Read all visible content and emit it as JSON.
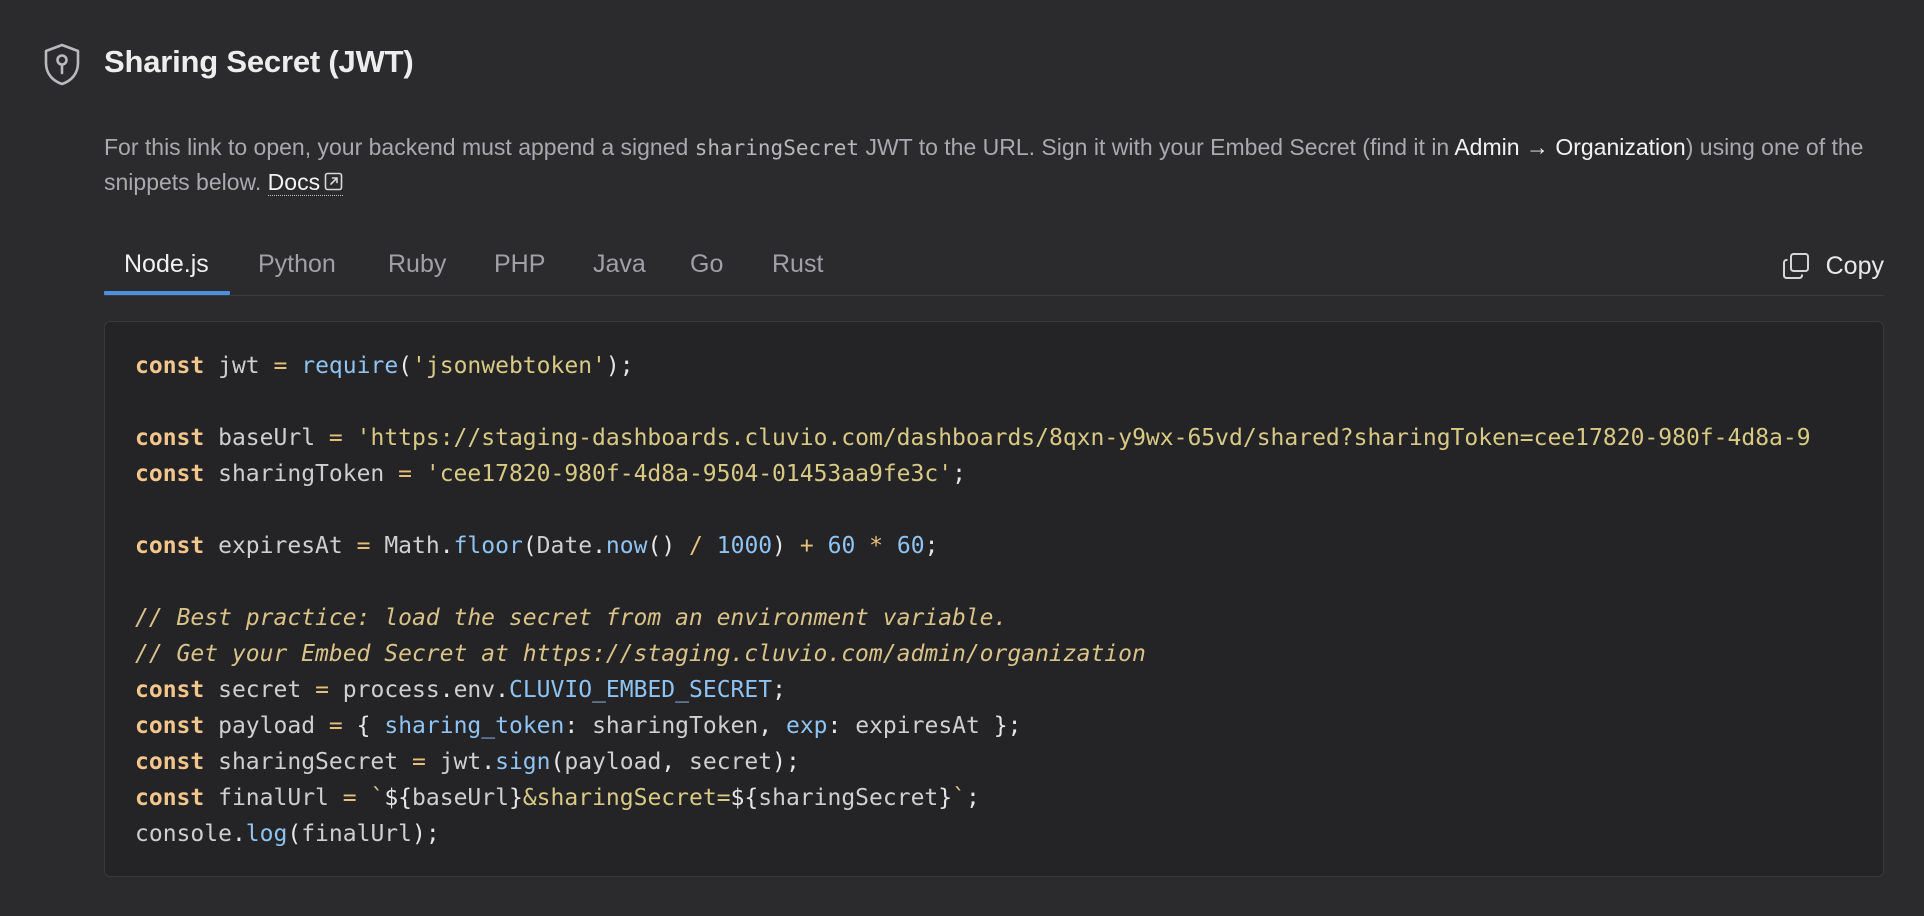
{
  "header": {
    "title": "Sharing Secret (JWT)",
    "icon": "shield-key-icon"
  },
  "description": {
    "part1": "For this link to open, your backend must append a signed ",
    "code": "sharingSecret",
    "part2": " JWT to the URL. Sign it with your Embed Secret (find it in ",
    "admin_path": "Admin → Organization",
    "part3": ") using one of the snippets below. ",
    "docs_label": "Docs"
  },
  "tabs": {
    "items": [
      "Node.js",
      "Python",
      "Ruby",
      "PHP",
      "Java",
      "Go",
      "Rust"
    ],
    "active": "Node.js"
  },
  "copy": {
    "label": "Copy"
  },
  "code": {
    "language": "Node.js",
    "lines": [
      "const jwt = require('jsonwebtoken');",
      "",
      "const baseUrl = 'https://staging-dashboards.cluvio.com/dashboards/8qxn-y9wx-65vd/shared?sharingToken=cee17820-980f-4d8a-9",
      "const sharingToken = 'cee17820-980f-4d8a-9504-01453aa9fe3c';",
      "",
      "const expiresAt = Math.floor(Date.now() / 1000) + 60 * 60;",
      "",
      "// Best practice: load the secret from an environment variable.",
      "// Get your Embed Secret at https://staging.cluvio.com/admin/organization",
      "const secret = process.env.CLUVIO_EMBED_SECRET;",
      "const payload = { sharing_token: sharingToken, exp: expiresAt };",
      "const sharingSecret = jwt.sign(payload, secret);",
      "const finalUrl = `${baseUrl}&sharingSecret=${sharingSecret}`;",
      "console.log(finalUrl);"
    ]
  },
  "colors": {
    "background": "#2b2b2d",
    "code_background": "#242426",
    "tab_accent": "#4b8fe0",
    "keyword": "#f3c68d",
    "function": "#8ec3f2",
    "string": "#d8ca85"
  }
}
